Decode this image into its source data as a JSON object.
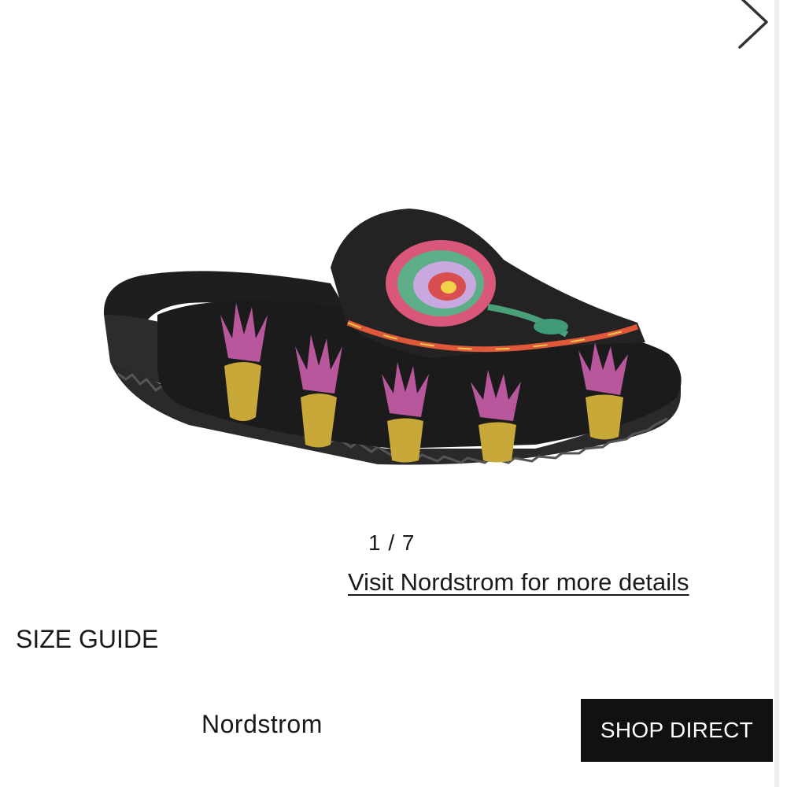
{
  "gallery": {
    "counter": "1 / 7",
    "product_image_subject": "embroidered-black-suede-mule",
    "next_icon": "chevron-right-icon"
  },
  "links": {
    "visit": "Visit Nordstrom for more details",
    "size_guide": "SIZE GUIDE"
  },
  "retailer": {
    "name": "Nordstrom",
    "button_label": "SHOP DIRECT"
  },
  "colors": {
    "button_bg": "#111111",
    "button_text": "#ffffff",
    "text": "#1a1a1a",
    "background": "#ffffff"
  }
}
